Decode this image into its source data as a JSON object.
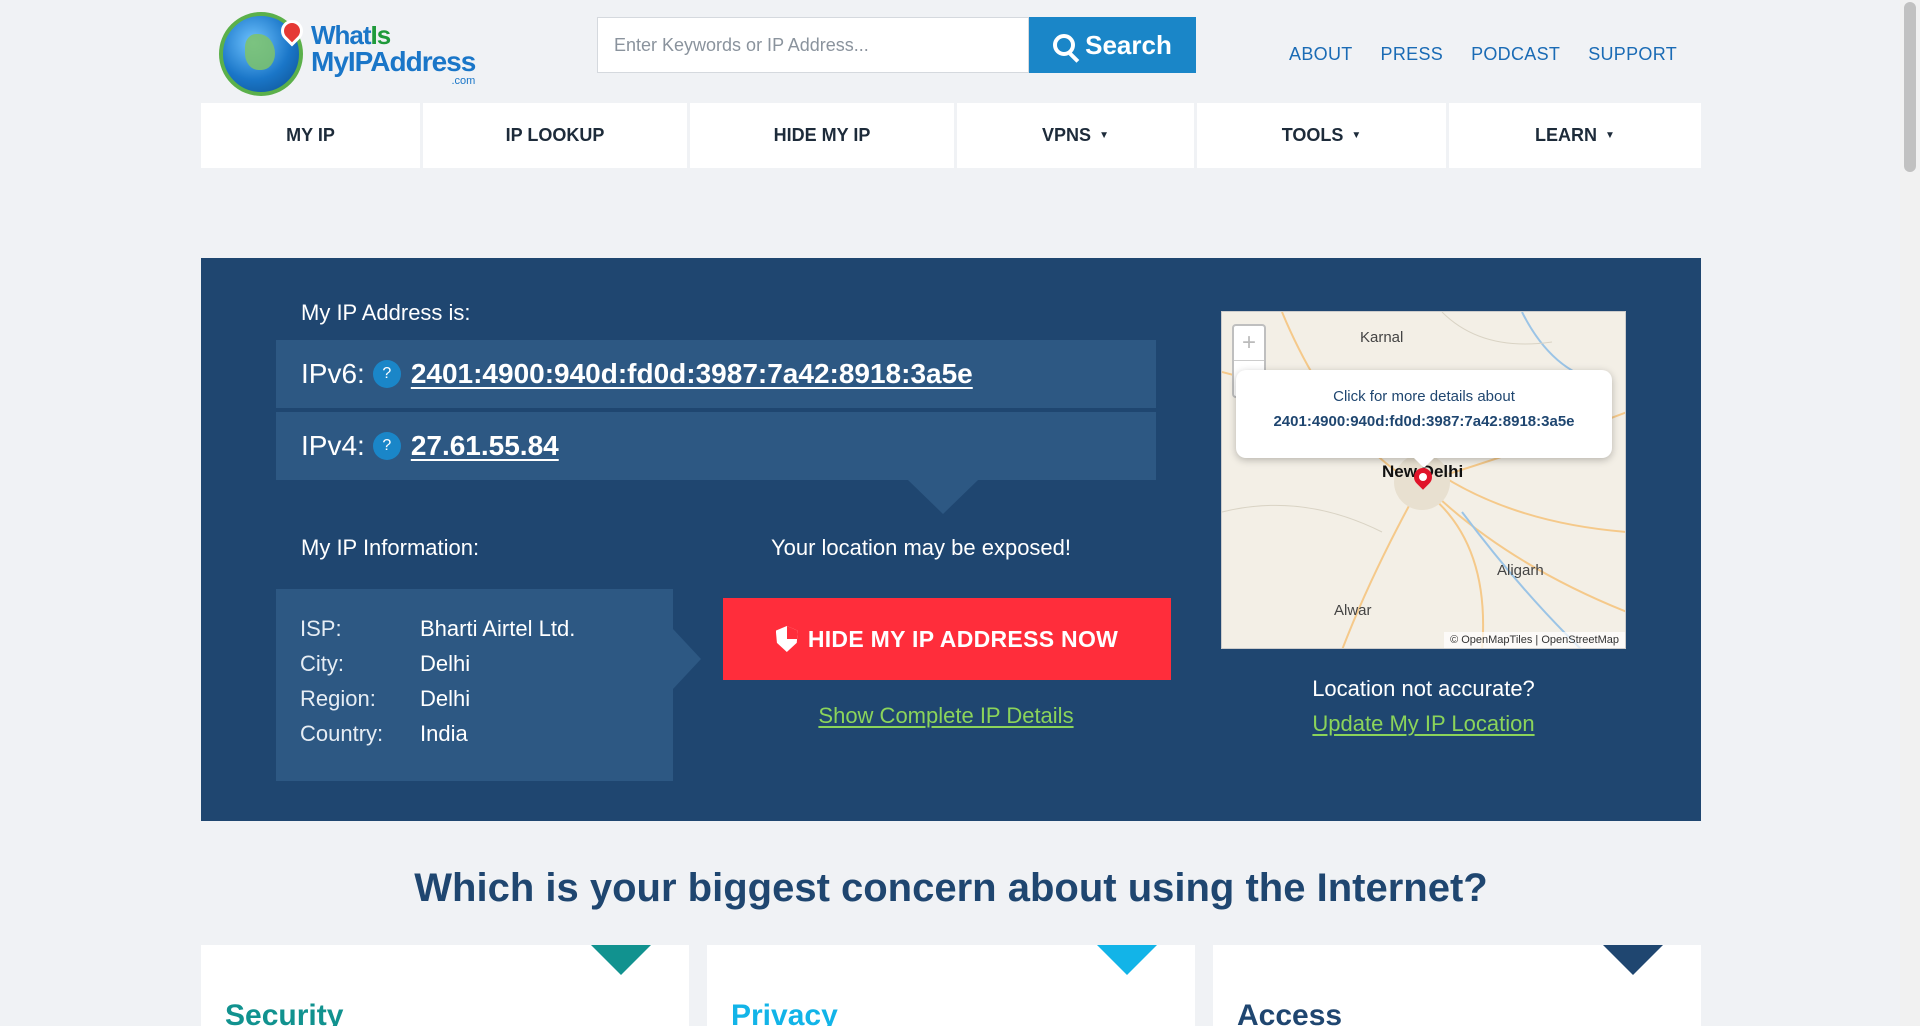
{
  "header": {
    "logo": {
      "line1a": "What",
      "line1b": "Is",
      "line2": "MyIPAddress",
      "line3": ".com"
    },
    "search": {
      "placeholder": "Enter Keywords or IP Address...",
      "button_label": "Search"
    },
    "links": [
      "ABOUT",
      "PRESS",
      "PODCAST",
      "SUPPORT"
    ]
  },
  "nav": {
    "items": [
      {
        "label": "MY IP",
        "dropdown": false
      },
      {
        "label": "IP LOOKUP",
        "dropdown": false
      },
      {
        "label": "HIDE MY IP",
        "dropdown": false
      },
      {
        "label": "VPNS",
        "dropdown": true
      },
      {
        "label": "TOOLS",
        "dropdown": true
      },
      {
        "label": "LEARN",
        "dropdown": true
      }
    ],
    "caret": "▼"
  },
  "hero": {
    "ip_label": "My IP Address is:",
    "ipv6_label": "IPv6:",
    "ipv6_value": "2401:4900:940d:fd0d:3987:7a42:8918:3a5e",
    "ipv4_label": "IPv4:",
    "ipv4_value": "27.61.55.84",
    "help": "?",
    "info_label": "My IP Information:",
    "info": [
      {
        "key": "ISP:",
        "value": "Bharti Airtel Ltd."
      },
      {
        "key": "City:",
        "value": "Delhi"
      },
      {
        "key": "Region:",
        "value": "Delhi"
      },
      {
        "key": "Country:",
        "value": "India"
      }
    ],
    "exposed_text": "Your location may be exposed!",
    "hide_button": "HIDE MY IP ADDRESS NOW",
    "details_link": "Show Complete IP Details",
    "map": {
      "zoom_in": "+",
      "zoom_out": "−",
      "popup_text": "Click for more details about",
      "popup_ip": "2401:4900:940d:fd0d:3987:7a42:8918:3a5e",
      "cities": [
        "Karnal",
        "New Delhi",
        "Aligarh",
        "Alwar"
      ],
      "attribution": "© OpenMapTiles | OpenStreetMap"
    },
    "loc_question": "Location not accurate?",
    "loc_update": "Update My IP Location"
  },
  "concern": {
    "title": "Which is your biggest concern about using the Internet?",
    "cards": [
      {
        "title": "Security",
        "color": "#11928f"
      },
      {
        "title": "Privacy",
        "color": "#12b4e8"
      },
      {
        "title": "Access",
        "color": "#1f4670"
      }
    ]
  },
  "colors": {
    "hero_bg": "#1f4670",
    "accent_red": "#ff2d3b",
    "link_green": "#8bd45a",
    "search_blue": "#1a86c8"
  }
}
